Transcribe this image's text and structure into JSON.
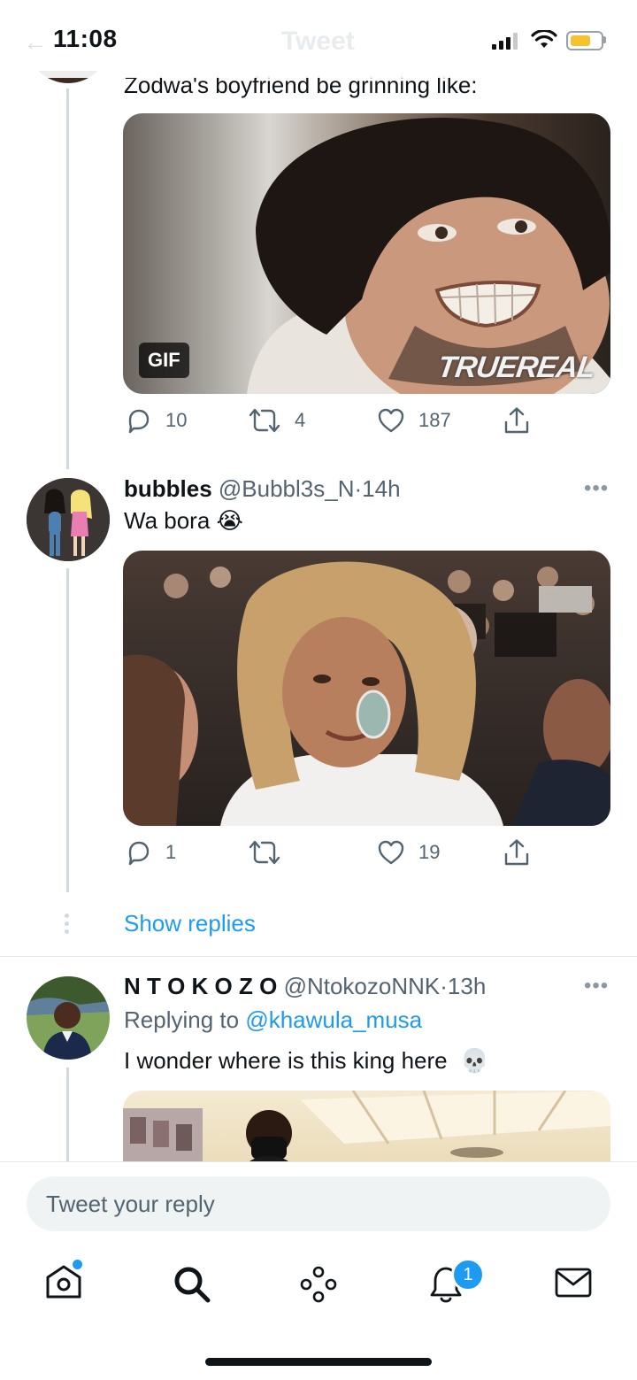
{
  "status_bar": {
    "time": "11:08"
  },
  "header": {
    "title": "Tweet"
  },
  "tweet1": {
    "text": "Zodwa's boyfriend be grinning like:",
    "gif_badge": "GIF",
    "watermark": "TRUEREAL",
    "replies": "10",
    "retweets": "4",
    "likes": "187"
  },
  "tweet2": {
    "name": "bubbles",
    "handle": "@Bubbl3s_N",
    "sep": "·",
    "time": "14h",
    "text": "Wa bora",
    "emoji": "😭",
    "replies": "1",
    "retweets": "",
    "likes": "19"
  },
  "show_replies": "Show replies",
  "tweet3": {
    "name": "N T O K O Z O",
    "handle": "@NtokozoNNK",
    "sep": "·",
    "time": "13h",
    "replying_prefix": "Replying to",
    "replying_to": "@khawula_musa",
    "text": "I wonder where is this king here",
    "emoji": "💀"
  },
  "composer": {
    "placeholder": "Tweet your reply"
  },
  "tabbar": {
    "notifications_badge": "1"
  },
  "colors": {
    "accent": "#1d9bf0",
    "thread_line": "#cfd9de",
    "muted": "#536471"
  }
}
